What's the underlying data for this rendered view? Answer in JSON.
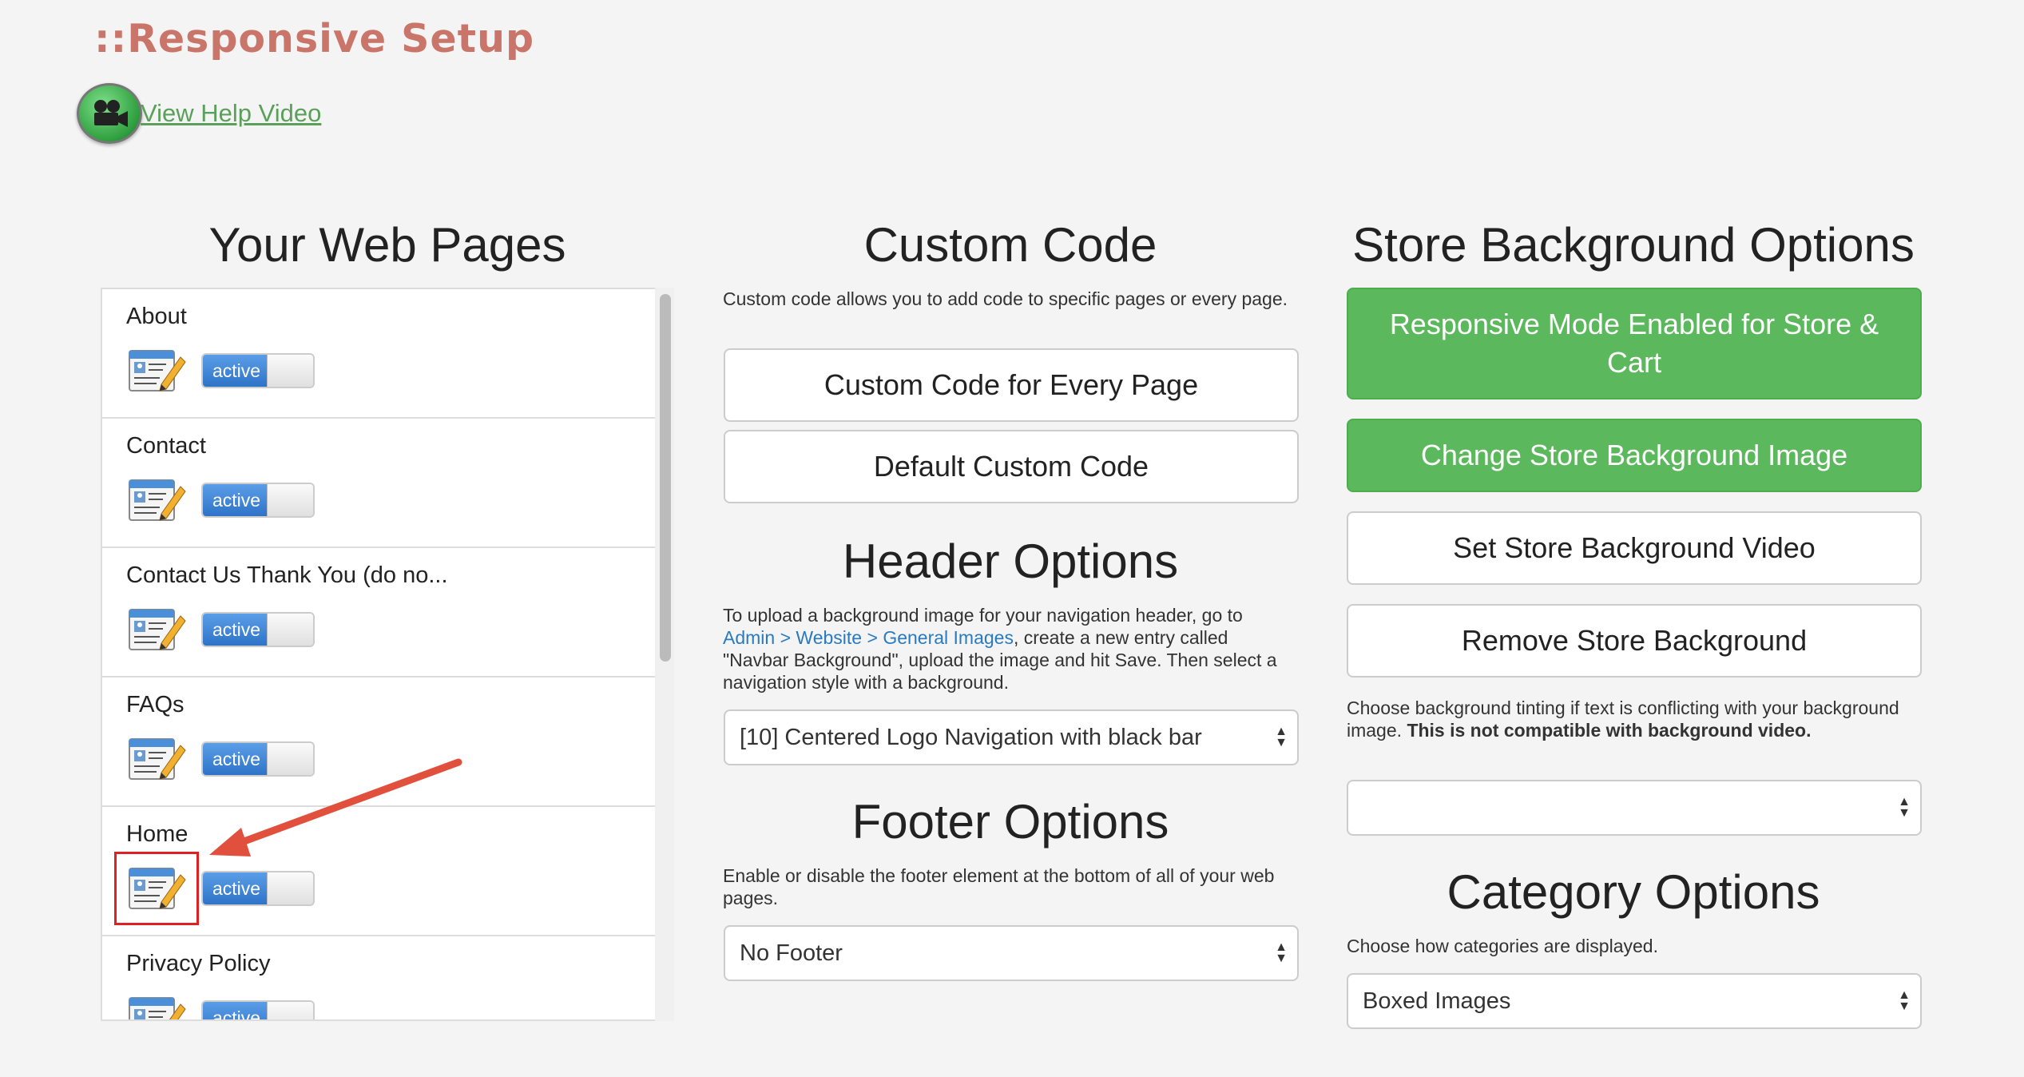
{
  "header": {
    "title": "::Responsive Setup",
    "help_link": "View Help Video"
  },
  "pages_column": {
    "title": "Your Web Pages",
    "pages": [
      {
        "name": "About",
        "status": "active"
      },
      {
        "name": "Contact",
        "status": "active"
      },
      {
        "name": "Contact Us Thank You (do no...",
        "status": "active"
      },
      {
        "name": "FAQs",
        "status": "active"
      },
      {
        "name": "Home",
        "status": "active"
      },
      {
        "name": "Privacy Policy",
        "status": "active"
      }
    ]
  },
  "custom_code": {
    "title": "Custom Code",
    "description": "Custom code allows you to add code to specific pages or every page.",
    "every_page_button": "Custom Code for Every Page",
    "default_button": "Default Custom Code"
  },
  "header_options": {
    "title": "Header Options",
    "desc_part1": "To upload a background image for your navigation header, go to",
    "link_admin": "Admin",
    "sep1": ">",
    "link_website": "Website",
    "sep2": ">",
    "link_general": "General Images",
    "desc_part2": ", create a new entry called \"Navbar Background\", upload the image and hit Save. Then select a navigation style with a background.",
    "selected": "[10] Centered Logo Navigation with black bar"
  },
  "footer_options": {
    "title": "Footer Options",
    "description": "Enable or disable the footer element at the bottom of all of your web pages.",
    "selected": "No Footer"
  },
  "store_background": {
    "title": "Store Background Options",
    "responsive_button": "Responsive Mode Enabled for Store & Cart",
    "change_image_button": "Change Store Background Image",
    "set_video_button": "Set Store Background Video",
    "remove_button": "Remove Store Background",
    "tint_desc": "Choose background tinting if text is conflicting with your background image.",
    "tint_note": "This is not compatible with background video.",
    "tint_selected": ""
  },
  "category_options": {
    "title": "Category Options",
    "description": "Choose how categories are displayed.",
    "selected": "Boxed Images"
  },
  "colors": {
    "title": "#c9756a",
    "green": "#5cb85c",
    "link": "#2a7ac0",
    "toggle_blue": "#2f73c8",
    "annotation_red": "#e0503c"
  }
}
